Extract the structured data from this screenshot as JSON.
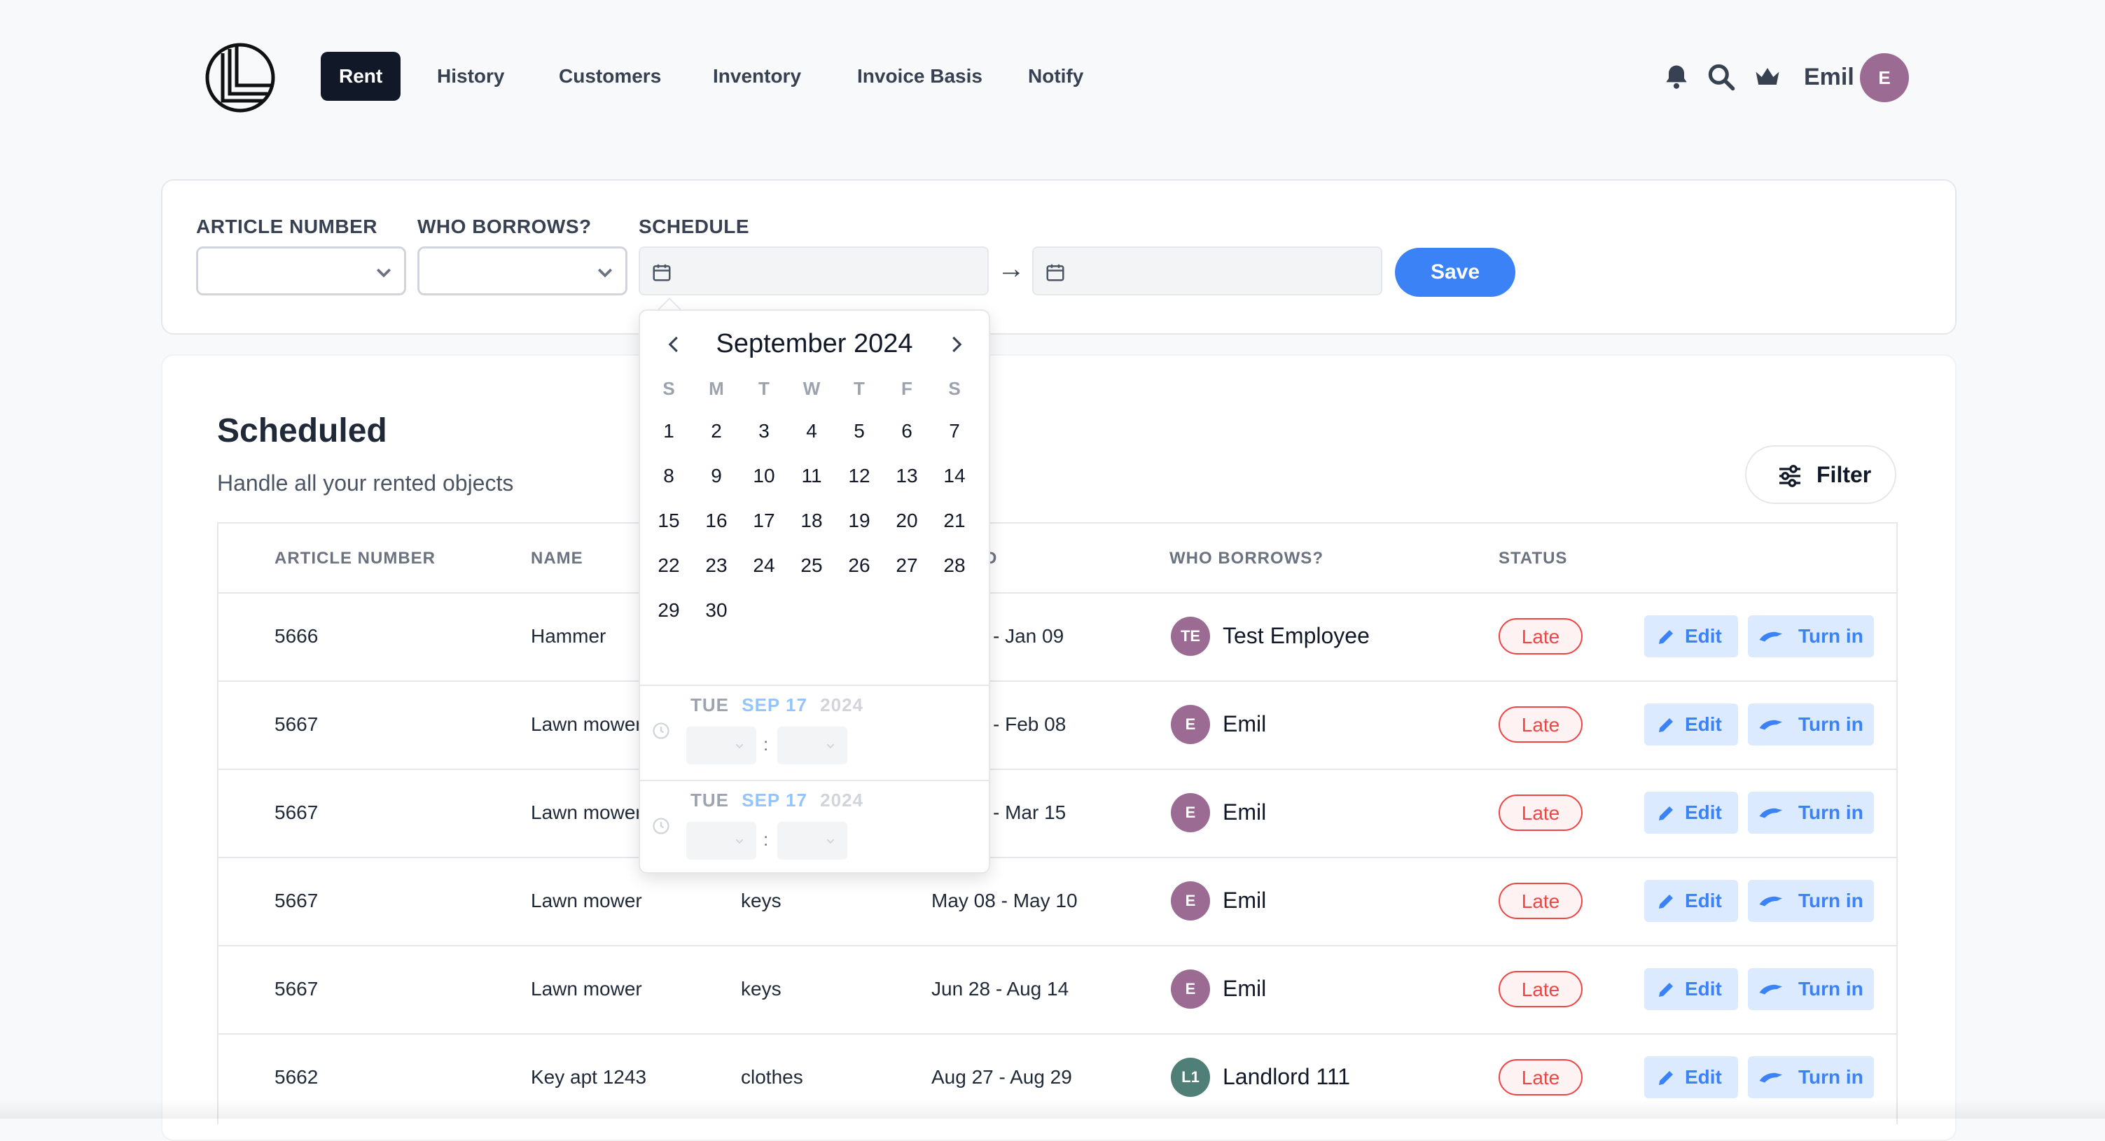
{
  "nav": {
    "links": [
      "Rent",
      "History",
      "Customers",
      "Inventory",
      "Invoice Basis",
      "Notify"
    ],
    "active": "Rent",
    "username": "Emil",
    "avatar_initial": "E",
    "avatar_color": "#9b6b93"
  },
  "form": {
    "article_label": "ARTICLE NUMBER",
    "borrower_label": "WHO BORROWS?",
    "schedule_label": "SCHEDULE",
    "arrow": "→",
    "save_label": "Save"
  },
  "calendar": {
    "month_label": "September 2024",
    "weekdays": [
      "S",
      "M",
      "T",
      "W",
      "T",
      "F",
      "S"
    ],
    "days": [
      "1",
      "2",
      "3",
      "4",
      "5",
      "6",
      "7",
      "8",
      "9",
      "10",
      "11",
      "12",
      "13",
      "14",
      "15",
      "16",
      "17",
      "18",
      "19",
      "20",
      "21",
      "22",
      "23",
      "24",
      "25",
      "26",
      "27",
      "28",
      "29",
      "30"
    ],
    "first_weekday_index": 0,
    "times": [
      {
        "dow": "TUE",
        "date": "SEP 17",
        "year": "2024"
      },
      {
        "dow": "TUE",
        "date": "SEP 17",
        "year": "2024"
      }
    ],
    "colon": ":"
  },
  "scheduled": {
    "title": "Scheduled",
    "subtitle": "Handle all your rented objects",
    "filter_label": "Filter",
    "headers": [
      "ARTICLE NUMBER",
      "NAME",
      "D",
      "WHO BORROWS?",
      "STATUS"
    ],
    "edit_label": "Edit",
    "turnin_label": "Turn in",
    "rows": [
      {
        "article": "5666",
        "name": "Hammer",
        "category": "",
        "period": "- Jan 09",
        "borrower": "Test Employee",
        "initials": "TE",
        "avatar_color": "#9b6b93",
        "status": "Late"
      },
      {
        "article": "5667",
        "name": "Lawn mower",
        "category": "",
        "period": "- Feb 08",
        "borrower": "Emil",
        "initials": "E",
        "avatar_color": "#9b6b93",
        "status": "Late"
      },
      {
        "article": "5667",
        "name": "Lawn mower",
        "category": "",
        "period": "- Mar 15",
        "borrower": "Emil",
        "initials": "E",
        "avatar_color": "#9b6b93",
        "status": "Late"
      },
      {
        "article": "5667",
        "name": "Lawn mower",
        "category": "keys",
        "period": "May 08 - May 10",
        "borrower": "Emil",
        "initials": "E",
        "avatar_color": "#9b6b93",
        "status": "Late"
      },
      {
        "article": "5667",
        "name": "Lawn mower",
        "category": "keys",
        "period": "Jun 28 - Aug 14",
        "borrower": "Emil",
        "initials": "E",
        "avatar_color": "#9b6b93",
        "status": "Late"
      },
      {
        "article": "5662",
        "name": "Key apt 1243",
        "category": "clothes",
        "period": "Aug 27 - Aug 29",
        "borrower": "Landlord 111",
        "initials": "L1",
        "avatar_color": "#4f7f76",
        "status": "Late"
      }
    ]
  }
}
